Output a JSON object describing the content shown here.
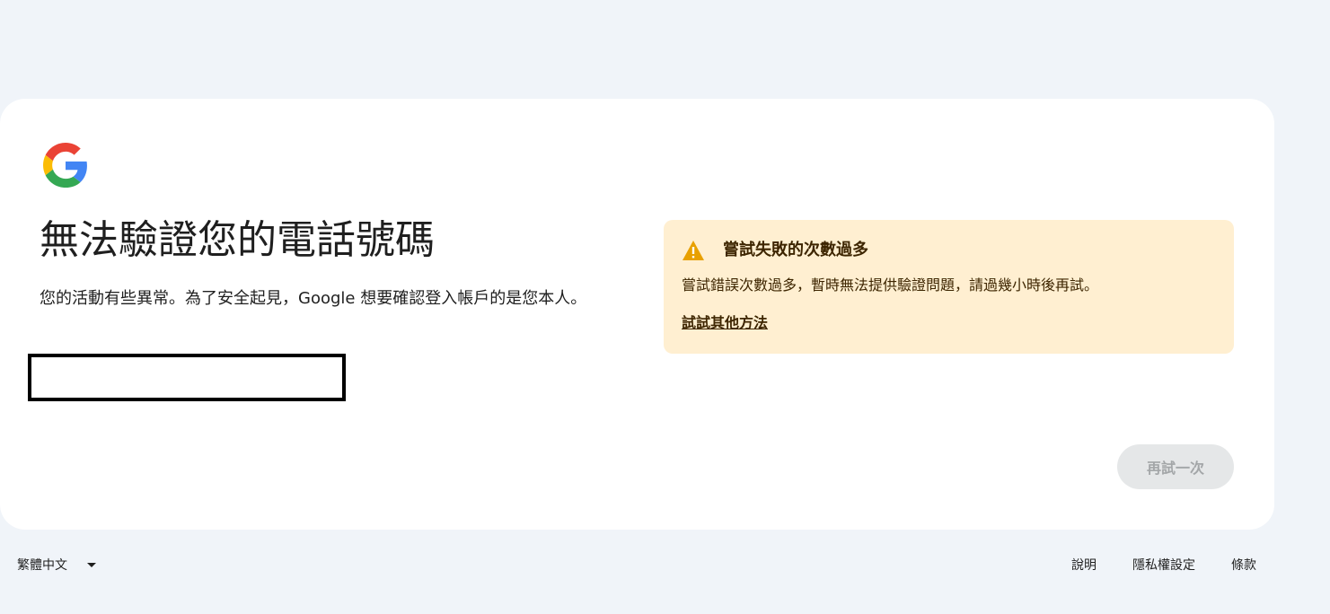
{
  "brand": {
    "logo_icon": "google-g-logo-icon",
    "colors": {
      "blue": "#4285F4",
      "red": "#EA4335",
      "yellow": "#FBBC05",
      "green": "#34A853"
    }
  },
  "main": {
    "title": "無法驗證您的電話號碼",
    "description": "您的活動有些異常。為了安全起見，Google 想要確認登入帳戶的是您本人。"
  },
  "alert": {
    "icon": "warning-icon",
    "icon_color": "#e8a000",
    "background": "#ffefd1",
    "title": "嘗試失敗的次數過多",
    "message": "嘗試錯誤次數過多，暫時無法提供驗證問題，請過幾小時後再試。",
    "link": "試試其他方法"
  },
  "actions": {
    "retry_label": "再試一次",
    "retry_disabled": true
  },
  "footer": {
    "language": "繁體中文",
    "language_icon": "caret-down-icon",
    "links": {
      "help": "說明",
      "privacy": "隱私權設定",
      "terms": "條款"
    }
  }
}
